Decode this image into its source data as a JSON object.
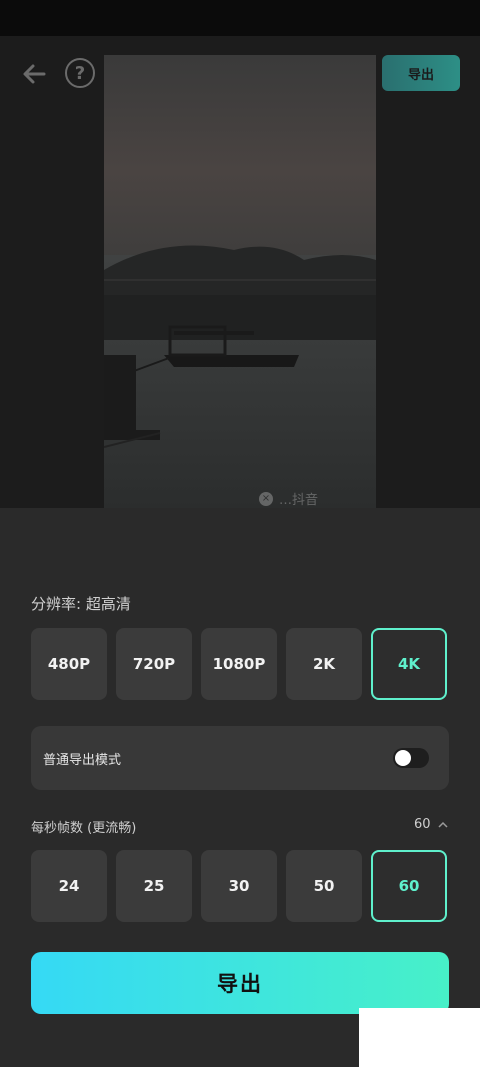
{
  "header": {
    "back_icon": "arrow-left-icon",
    "help_icon": "question-circle-icon",
    "help_glyph": "?",
    "export_label": "导出"
  },
  "preview": {
    "watermark_close_glyph": "×",
    "watermark_text": "…抖音"
  },
  "resolution": {
    "label": "分辨率: 超高清",
    "options": [
      "480P",
      "720P",
      "1080P",
      "2K",
      "4K"
    ],
    "selected": "4K"
  },
  "export_mode": {
    "label": "普通导出模式",
    "toggle_on": false
  },
  "fps": {
    "label": "每秒帧数 (更流畅)",
    "current": "60",
    "options": [
      "24",
      "25",
      "30",
      "50",
      "60"
    ],
    "selected": "60"
  },
  "footer": {
    "export_label": "导出"
  },
  "colors": {
    "accent": "#5ff0cc",
    "button_gradient_start": "#35d9f5",
    "button_gradient_end": "#47f0c8",
    "panel_bg": "#2a2a2a"
  }
}
